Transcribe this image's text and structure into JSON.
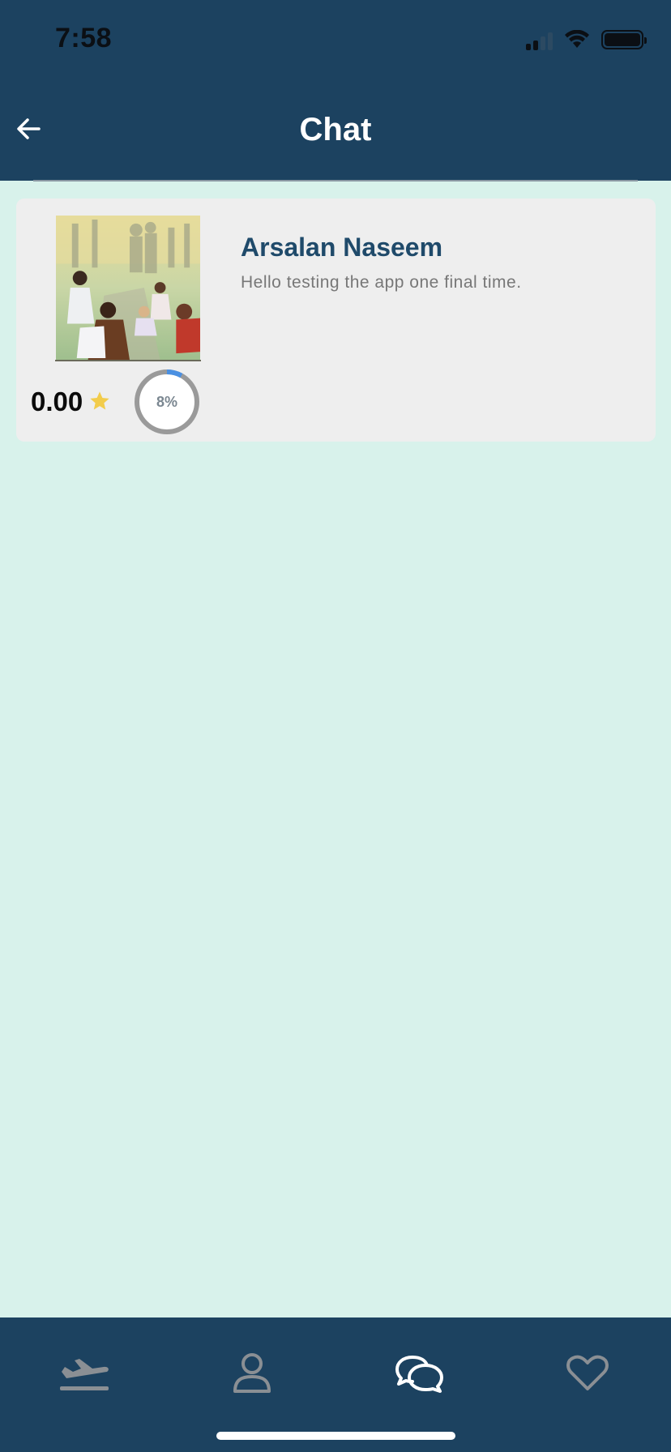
{
  "status_bar": {
    "time": "7:58"
  },
  "header": {
    "title": "Chat"
  },
  "chats": [
    {
      "name": "Arsalan Naseem",
      "last_message": "Hello testing the app one final time.",
      "rating": "0.00",
      "progress_label": "8%",
      "progress": 0.08
    }
  ],
  "tab_bar": {
    "items": [
      {
        "icon": "plane-landing-icon",
        "active": false
      },
      {
        "icon": "profile-icon",
        "active": false
      },
      {
        "icon": "chat-bubbles-icon",
        "active": true
      },
      {
        "icon": "heart-icon",
        "active": false
      }
    ]
  },
  "colors": {
    "header_bg": "#1c4260",
    "page_bg": "#d8f2eb",
    "card_bg": "#eeeeee",
    "name_color": "#1f4a6a",
    "star_color": "#f2cc4b",
    "progress_arc": "#4a90e2",
    "inactive_tab": "#8a8f94",
    "active_tab": "#ffffff"
  }
}
